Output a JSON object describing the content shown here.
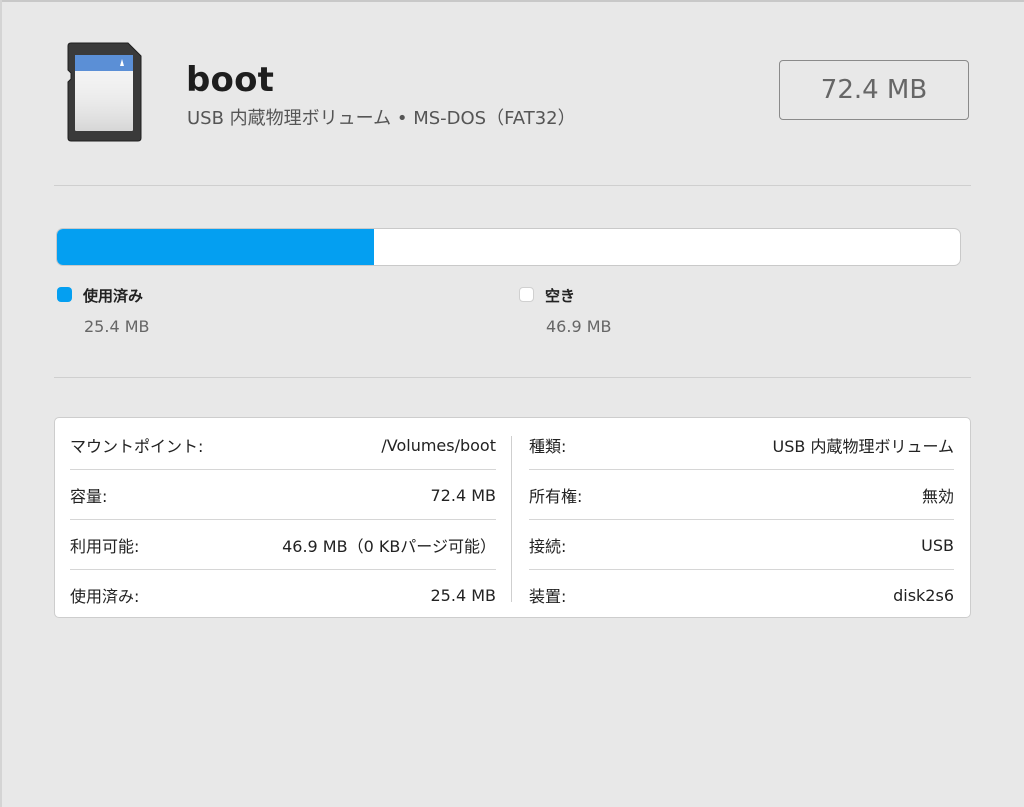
{
  "volume": {
    "name": "boot",
    "subtitle": "USB 内蔵物理ボリューム • MS-DOS（FAT32）",
    "capacity": "72.4 MB"
  },
  "usage": {
    "used_fraction": 0.351,
    "used_color": "#049ff1",
    "free_color": "#ffffff",
    "used_label": "使用済み",
    "used_value": "25.4 MB",
    "free_label": "空き",
    "free_value": "46.9 MB"
  },
  "info": {
    "left": [
      {
        "key": "マウントポイント:",
        "value": "/Volumes/boot"
      },
      {
        "key": "容量:",
        "value": "72.4 MB"
      },
      {
        "key": "利用可能:",
        "value": "46.9 MB（0 KBパージ可能）"
      },
      {
        "key": "使用済み:",
        "value": "25.4 MB"
      }
    ],
    "right": [
      {
        "key": "種類:",
        "value": "USB 内蔵物理ボリューム"
      },
      {
        "key": "所有権:",
        "value": "無効"
      },
      {
        "key": "接続:",
        "value": "USB"
      },
      {
        "key": "装置:",
        "value": "disk2s6"
      }
    ]
  },
  "icons": {
    "volume_icon": "sd-card-icon"
  }
}
